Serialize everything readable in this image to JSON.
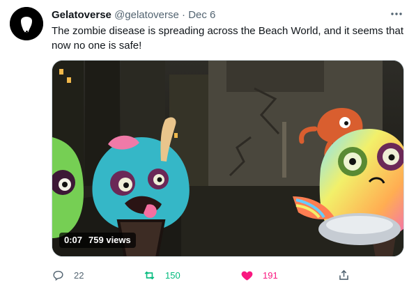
{
  "tweet": {
    "author_name": "Gelatoverse",
    "author_handle": "@gelatoverse",
    "separator": "·",
    "date": "Dec 6",
    "text": "The zombie disease is spreading across the Beach World, and it seems that now no one is safe!",
    "video": {
      "time": "0:07",
      "views": "759 views"
    },
    "actions": {
      "reply_count": "22",
      "retweet_count": "150",
      "like_count": "191"
    }
  },
  "colors": {
    "retweet_active": "#00ba7c",
    "like_active": "#f91880",
    "secondary_text": "#536471"
  },
  "icons": [
    "avatar-drip-icon",
    "more-icon",
    "reply-icon",
    "retweet-icon",
    "heart-icon",
    "share-icon"
  ]
}
